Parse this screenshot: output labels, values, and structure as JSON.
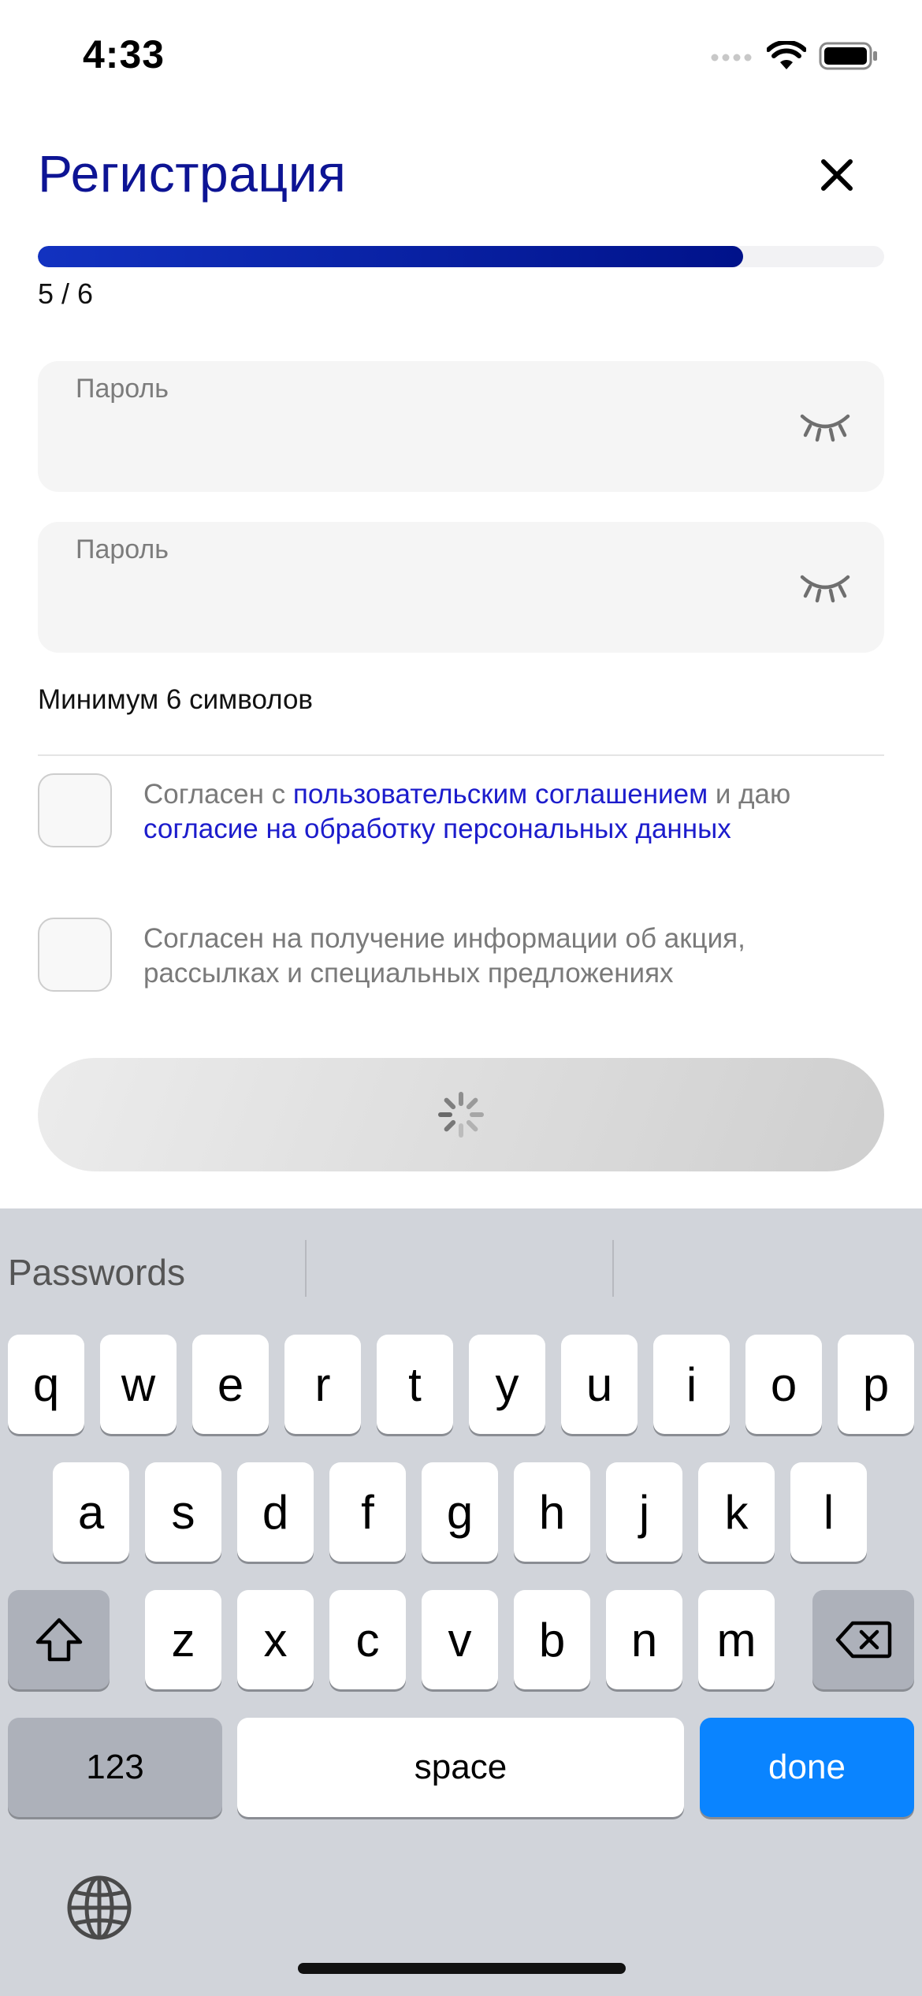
{
  "status": {
    "time": "4:33"
  },
  "header": {
    "title": "Регистрация"
  },
  "progress": {
    "text": "5 / 6",
    "fraction": 0.833
  },
  "fields": [
    {
      "label": "Пароль",
      "value": ""
    },
    {
      "label": "Пароль",
      "value": ""
    }
  ],
  "hint": "Минимум 6 символов",
  "agreements": {
    "terms": {
      "prefix": "Согласен с ",
      "link1": "пользовательским соглашением",
      "middle": " и даю ",
      "link2": "согласие на обработку персональных данных"
    },
    "marketing": {
      "text": "Согласен на получение информации об акция, рассылках и специальных предложениях"
    }
  },
  "keyboard": {
    "suggestion": "Passwords",
    "row1": [
      "q",
      "w",
      "e",
      "r",
      "t",
      "y",
      "u",
      "i",
      "o",
      "p"
    ],
    "row2": [
      "a",
      "s",
      "d",
      "f",
      "g",
      "h",
      "j",
      "k",
      "l"
    ],
    "row3": [
      "z",
      "x",
      "c",
      "v",
      "b",
      "n",
      "m"
    ],
    "numbers_label": "123",
    "space_label": "space",
    "done_label": "done"
  },
  "colors": {
    "accent": "#0d1494",
    "link": "#1c1ccc",
    "done": "#0a84ff"
  }
}
